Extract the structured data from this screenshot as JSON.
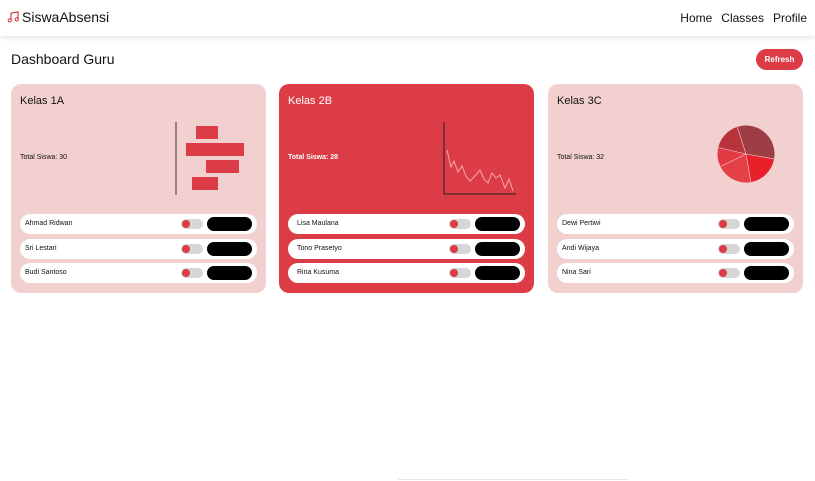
{
  "app": {
    "brand": "SiswaAbsensi",
    "brand_icon": "music-note-icon",
    "nav": [
      "Home",
      "Classes",
      "Profile"
    ]
  },
  "page": {
    "title": "Dashboard Guru",
    "refresh_label": "Refresh"
  },
  "colors": {
    "accent": "#dc3c45",
    "card_light": "#f2d0d0",
    "card_dark": "#dc3c45"
  },
  "classes": [
    {
      "name": "Kelas 1A",
      "total_label": "Total Siswa: 30",
      "chart": "horizontal-bar",
      "students": [
        "Ahmad Ridwan",
        "Sri Lestari",
        "Budi Santoso"
      ]
    },
    {
      "name": "Kelas 2B",
      "total_label": "Total Siswa: 28",
      "chart": "line",
      "students": [
        "Lisa Maulana",
        "Tono Prasetyo",
        "Rina Kusuma"
      ]
    },
    {
      "name": "Kelas 3C",
      "total_label": "Total Siswa: 32",
      "chart": "pie",
      "students": [
        "Dewi Pertiwi",
        "Andi Wijaya",
        "Nina Sari"
      ]
    }
  ]
}
